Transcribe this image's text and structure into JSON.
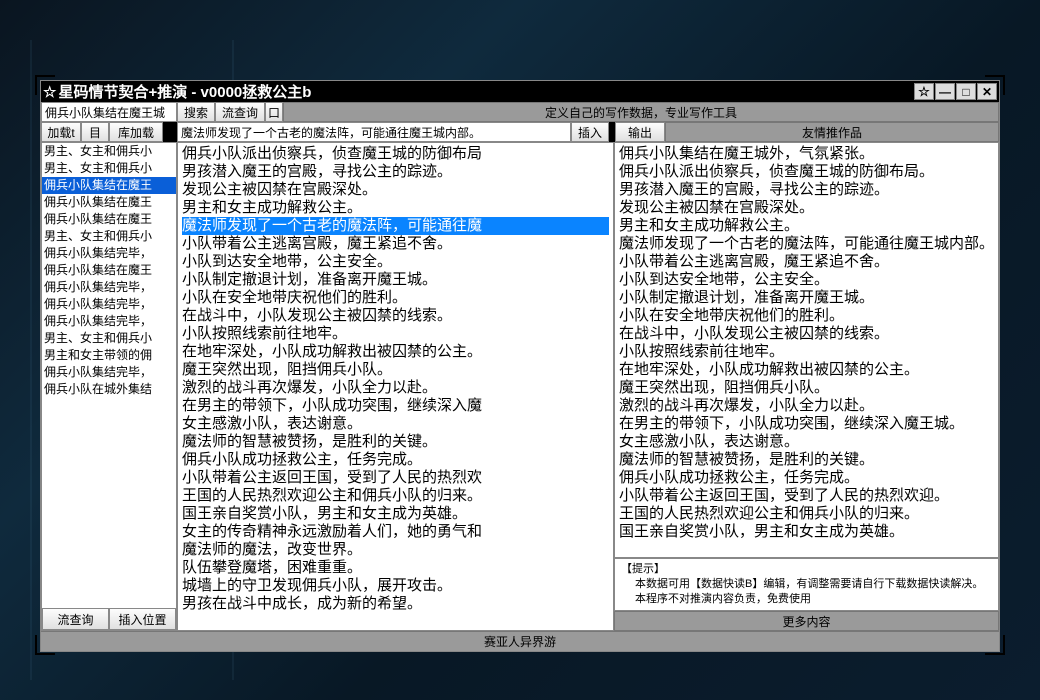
{
  "title": "星码情节契合+推演  -  v0000拯救公主b",
  "toolbar1": {
    "search_field": "佣兵小队集结在魔王城",
    "search_btn": "搜索",
    "flow_query_btn": "流查询",
    "sq_btn": "口",
    "right_banner": "定义自己的写作数据，专业写作工具"
  },
  "toolbar2": {
    "load_btn": "加载t",
    "list_btn": "目",
    "lib_btn": "库加载",
    "magic_field": "魔法师发现了一个古老的魔法阵，可能通往魔王城内部。",
    "insert_btn": "插入",
    "output_btn": "输出",
    "recommend_bar": "友情推作品"
  },
  "left_list": [
    "男主、女主和佣兵小",
    "男主、女主和佣兵小",
    "佣兵小队集结在魔王",
    "佣兵小队集结在魔王",
    "佣兵小队集结在魔王",
    "男主、女主和佣兵小",
    "佣兵小队集结完毕，",
    "佣兵小队集结在魔王",
    "佣兵小队集结完毕，",
    "佣兵小队集结完毕，",
    "佣兵小队集结完毕，",
    "男主、女主和佣兵小",
    "男主和女主带领的佣",
    "佣兵小队集结完毕，",
    "佣兵小队在城外集结"
  ],
  "left_selected_index": 2,
  "left_bottom": {
    "flow_btn": "流查询",
    "insert_pos_btn": "插入位置"
  },
  "mid_story": [
    "佣兵小队派出侦察兵，侦查魔王城的防御布局",
    "男孩潜入魔王的宫殿，寻找公主的踪迹。",
    "发现公主被囚禁在宫殿深处。",
    "男主和女主成功解救公主。",
    "魔法师发现了一个古老的魔法阵，可能通往魔",
    "小队带着公主逃离宫殿，魔王紧追不舍。",
    "小队到达安全地带，公主安全。",
    "小队制定撤退计划，准备离开魔王城。",
    "小队在安全地带庆祝他们的胜利。",
    "在战斗中，小队发现公主被囚禁的线索。",
    "小队按照线索前往地牢。",
    "在地牢深处，小队成功解救出被囚禁的公主。",
    "魔王突然出现，阻挡佣兵小队。",
    "激烈的战斗再次爆发，小队全力以赴。",
    "在男主的带领下，小队成功突围，继续深入魔",
    "女主感激小队，表达谢意。",
    "魔法师的智慧被赞扬，是胜利的关键。",
    "佣兵小队成功拯救公主，任务完成。",
    "小队带着公主返回王国，受到了人民的热烈欢",
    "王国的人民热烈欢迎公主和佣兵小队的归来。",
    "国王亲自奖赏小队，男主和女主成为英雄。",
    "女主的传奇精神永远激励着人们，她的勇气和",
    "魔法师的魔法，改变世界。",
    "队伍攀登魔塔，困难重重。",
    "城墙上的守卫发现佣兵小队，展开攻击。",
    "男孩在战斗中成长，成为新的希望。"
  ],
  "mid_highlight_index": 4,
  "right_story": [
    "佣兵小队集结在魔王城外，气氛紧张。",
    "佣兵小队派出侦察兵，侦查魔王城的防御布局。",
    "男孩潜入魔王的宫殿，寻找公主的踪迹。",
    "发现公主被囚禁在宫殿深处。",
    "男主和女主成功解救公主。",
    "魔法师发现了一个古老的魔法阵，可能通往魔王城内部。",
    "小队带着公主逃离宫殿，魔王紧追不舍。",
    "小队到达安全地带，公主安全。",
    "小队制定撤退计划，准备离开魔王城。",
    "小队在安全地带庆祝他们的胜利。",
    "在战斗中，小队发现公主被囚禁的线索。",
    "小队按照线索前往地牢。",
    "在地牢深处，小队成功解救出被囚禁的公主。",
    "魔王突然出现，阻挡佣兵小队。",
    "激烈的战斗再次爆发，小队全力以赴。",
    "在男主的带领下，小队成功突围，继续深入魔王城。",
    "女主感激小队，表达谢意。",
    "魔法师的智慧被赞扬，是胜利的关键。",
    "佣兵小队成功拯救公主，任务完成。",
    "小队带着公主返回王国，受到了人民的热烈欢迎。",
    "王国的人民热烈欢迎公主和佣兵小队的归来。",
    "国王亲自奖赏小队，男主和女主成为英雄。"
  ],
  "hint": {
    "title": "【提示】",
    "line1": "本数据可用【数据快读B】编辑，有调整需要请自行下载数据快读解决。",
    "line2": "本程序不对推演内容负责，免费使用"
  },
  "more_btn": "更多内容",
  "footer": "赛亚人异界游"
}
